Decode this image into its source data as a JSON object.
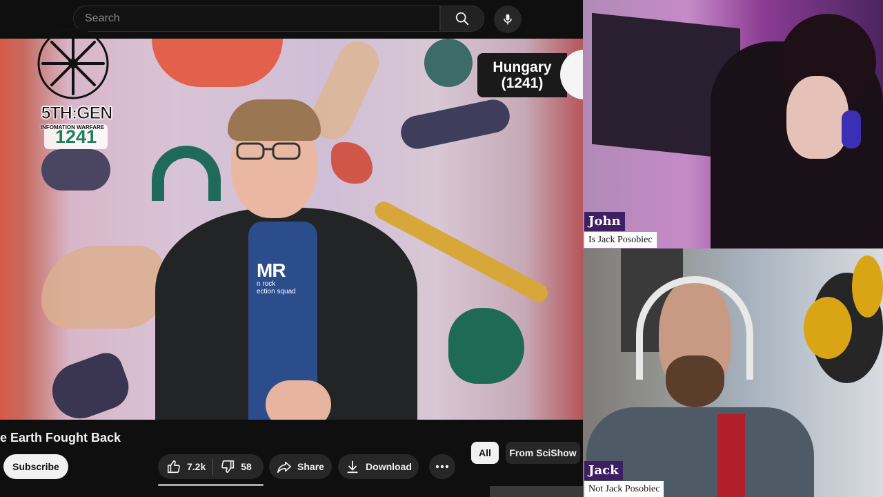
{
  "youtube": {
    "search": {
      "placeholder": "Search"
    },
    "video": {
      "overlay_country": "Hungary",
      "overlay_year": "(1241)",
      "corner_year": "1241",
      "shirt_logo": "MR",
      "shirt_text": "n rock\nection squad",
      "channel_logo": {
        "title": "5TH:GEN",
        "subtitle": "INFOMATION WARFARE"
      }
    },
    "title": "e Earth Fought Back",
    "subscribe_label": "Subscribe",
    "like_count": "7.2k",
    "dislike_count": "58",
    "share_label": "Share",
    "download_label": "Download",
    "chips": [
      "All",
      "From SciShow"
    ]
  },
  "cams": {
    "john": {
      "name": "John",
      "subtitle": "Is Jack Posobiec"
    },
    "jack": {
      "name": "Jack",
      "subtitle": "Not Jack Posobiec"
    }
  },
  "colors": {
    "name_plate_bg": "#3e1f63",
    "subscribe_bg": "#f1f1f1",
    "like_bar_bg": "#272727"
  }
}
